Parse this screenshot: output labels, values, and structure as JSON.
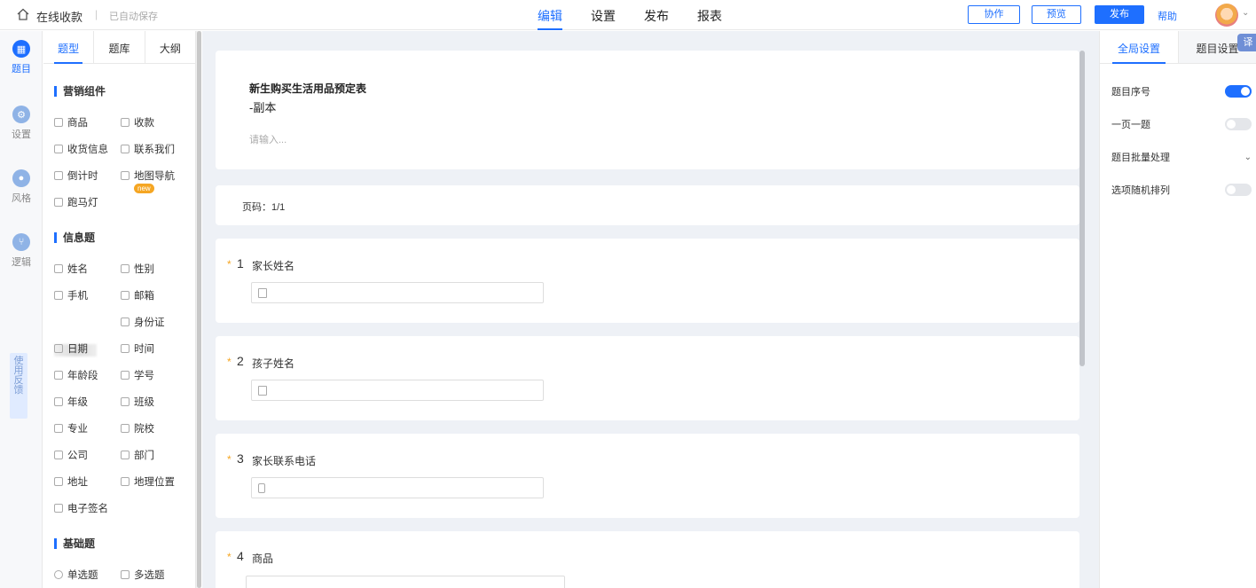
{
  "header": {
    "app_title": "在线收款",
    "separator": "|",
    "autosave": "已自动保存",
    "nav": [
      {
        "label": "编辑",
        "active": true
      },
      {
        "label": "设置",
        "active": false
      },
      {
        "label": "发布",
        "active": false
      },
      {
        "label": "报表",
        "active": false
      }
    ],
    "collab_label": "协作",
    "preview_label": "预览",
    "publish_label": "发布",
    "help_label": "帮助"
  },
  "rail": {
    "items": [
      {
        "label": "题目",
        "icon": "grid-icon",
        "active": true
      },
      {
        "label": "设置",
        "icon": "gear-icon",
        "active": false
      },
      {
        "label": "风格",
        "icon": "palette-icon",
        "active": false
      },
      {
        "label": "逻辑",
        "icon": "logic-icon",
        "active": false
      }
    ],
    "feedback": "使用反馈"
  },
  "comp_panel": {
    "tabs": [
      {
        "label": "题型",
        "active": true
      },
      {
        "label": "题库",
        "active": false
      },
      {
        "label": "大纲",
        "active": false
      }
    ],
    "sections": [
      {
        "title": "营销组件",
        "items": [
          "商品",
          "收款",
          "收货信息",
          "联系我们",
          "倒计时",
          "地图导航",
          "跑马灯"
        ]
      },
      {
        "title": "信息题",
        "items": [
          "姓名",
          "性别",
          "手机",
          "邮箱",
          "身份证",
          "日期",
          "时间",
          "年龄段",
          "学号",
          "年级",
          "班级",
          "专业",
          "院校",
          "公司",
          "部门",
          "地址",
          "地理位置",
          "电子签名"
        ]
      },
      {
        "title": "基础题",
        "items": [
          "单选题",
          "多选题"
        ]
      }
    ],
    "new_badge": "new"
  },
  "canvas": {
    "form_title": "新生购买生活用品预定表",
    "form_subtitle": "-副本",
    "desc_placeholder": "请输入...",
    "page_code": "页码：1/1",
    "questions": [
      {
        "num": "1",
        "title": "家长姓名",
        "required": true,
        "icon": "person-card-icon"
      },
      {
        "num": "2",
        "title": "孩子姓名",
        "required": true,
        "icon": "person-card-icon"
      },
      {
        "num": "3",
        "title": "家长联系电话",
        "required": true,
        "icon": "phone-icon"
      },
      {
        "num": "4",
        "title": "商品",
        "required": true,
        "icon": ""
      }
    ]
  },
  "right_panel": {
    "tabs": [
      {
        "label": "全局设置",
        "active": true
      },
      {
        "label": "题目设置",
        "active": false
      }
    ],
    "translate": "译",
    "settings": [
      {
        "label": "题目序号",
        "type": "toggle",
        "on": true
      },
      {
        "label": "一页一题",
        "type": "toggle",
        "on": false
      },
      {
        "label": "题目批量处理",
        "type": "dropdown"
      },
      {
        "label": "选项随机排列",
        "type": "toggle",
        "on": false
      }
    ]
  }
}
